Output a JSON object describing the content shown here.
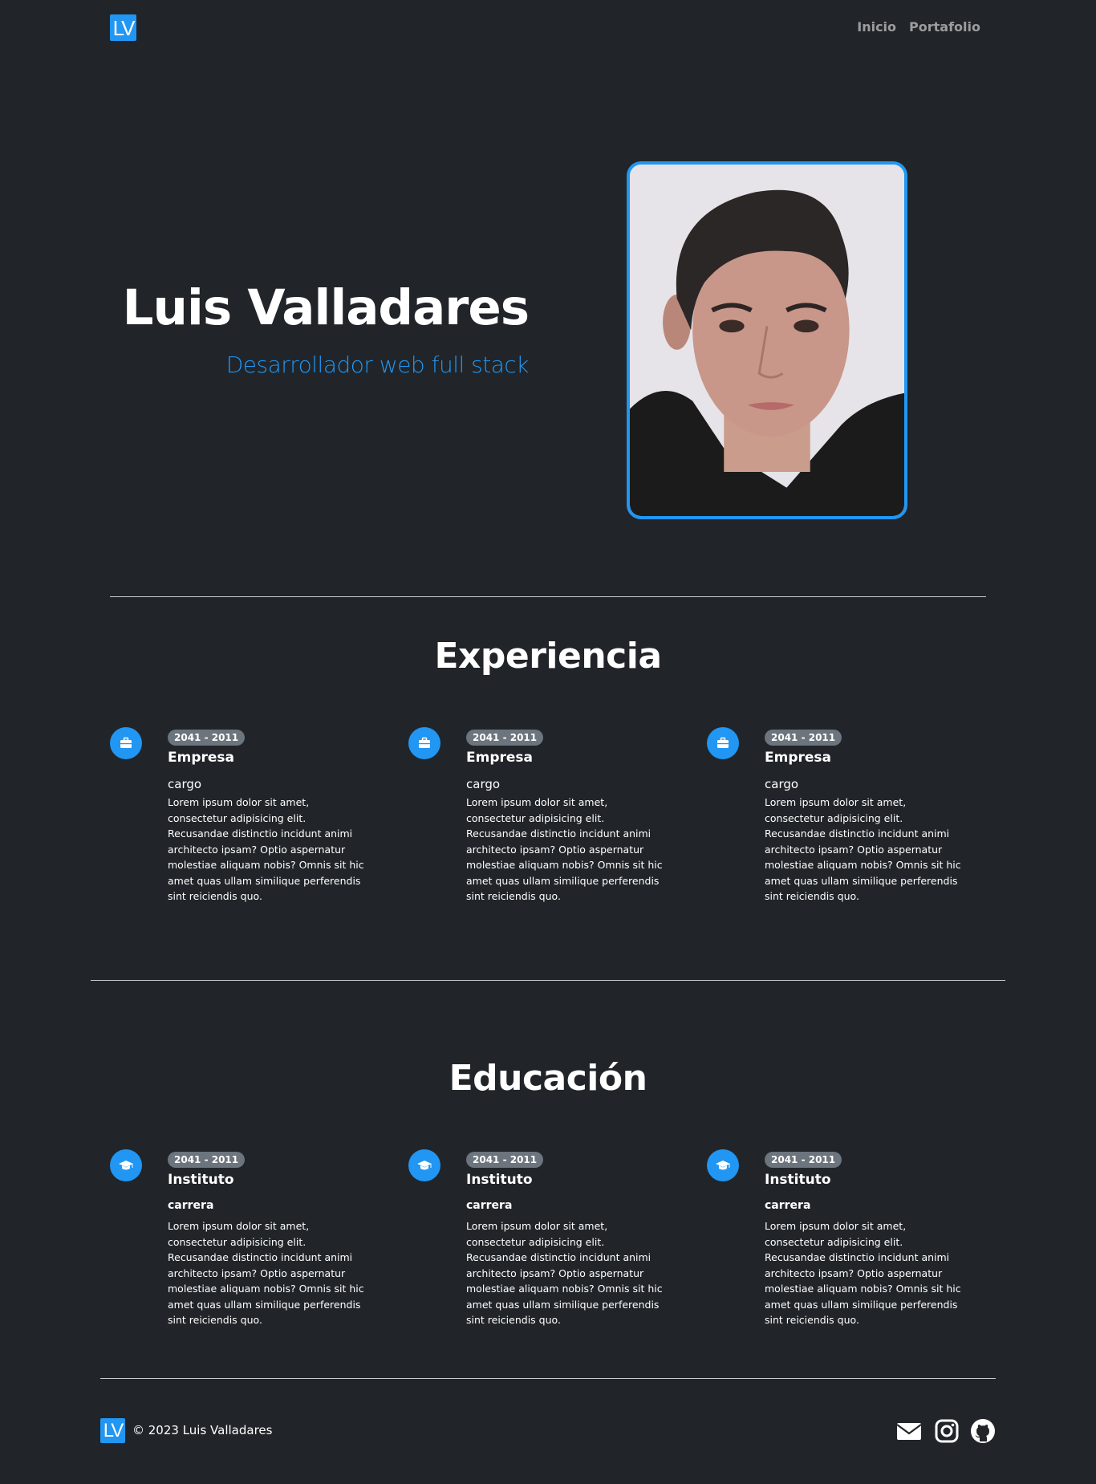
{
  "brand": {
    "logo_text": "LV",
    "logo_color": "#2196f3"
  },
  "nav": {
    "links": [
      {
        "label": "Inicio"
      },
      {
        "label": "Portafolio"
      }
    ]
  },
  "hero": {
    "name": "Luis Valladares",
    "role": "Desarrollador web full stack"
  },
  "experience": {
    "title": "Experiencia",
    "items": [
      {
        "icon": "briefcase-icon",
        "dates": "2041 - 2011",
        "company": "Empresa",
        "position": "cargo",
        "description": "Lorem ipsum dolor sit amet, consectetur adipisicing elit. Recusandae distinctio incidunt animi architecto ipsam? Optio aspernatur molestiae aliquam nobis? Omnis sit hic amet quas ullam similique perferendis sint reiciendis quo."
      },
      {
        "icon": "briefcase-icon",
        "dates": "2041 - 2011",
        "company": "Empresa",
        "position": "cargo",
        "description": "Lorem ipsum dolor sit amet, consectetur adipisicing elit. Recusandae distinctio incidunt animi architecto ipsam? Optio aspernatur molestiae aliquam nobis? Omnis sit hic amet quas ullam similique perferendis sint reiciendis quo."
      },
      {
        "icon": "briefcase-icon",
        "dates": "2041 - 2011",
        "company": "Empresa",
        "position": "cargo",
        "description": "Lorem ipsum dolor sit amet, consectetur adipisicing elit. Recusandae distinctio incidunt animi architecto ipsam? Optio aspernatur molestiae aliquam nobis? Omnis sit hic amet quas ullam similique perferendis sint reiciendis quo."
      }
    ]
  },
  "education": {
    "title": "Educación",
    "items": [
      {
        "icon": "graduation-cap-icon",
        "dates": "2041 - 2011",
        "institution": "Instituto",
        "program": "carrera",
        "description": "Lorem ipsum dolor sit amet, consectetur adipisicing elit. Recusandae distinctio incidunt animi architecto ipsam? Optio aspernatur molestiae aliquam nobis? Omnis sit hic amet quas ullam similique perferendis sint reiciendis quo."
      },
      {
        "icon": "graduation-cap-icon",
        "dates": "2041 - 2011",
        "institution": "Instituto",
        "program": "carrera",
        "description": "Lorem ipsum dolor sit amet, consectetur adipisicing elit. Recusandae distinctio incidunt animi architecto ipsam? Optio aspernatur molestiae aliquam nobis? Omnis sit hic amet quas ullam similique perferendis sint reiciendis quo."
      },
      {
        "icon": "graduation-cap-icon",
        "dates": "2041 - 2011",
        "institution": "Instituto",
        "program": "carrera",
        "description": "Lorem ipsum dolor sit amet, consectetur adipisicing elit. Recusandae distinctio incidunt animi architecto ipsam? Optio aspernatur molestiae aliquam nobis? Omnis sit hic amet quas ullam similique perferendis sint reiciendis quo."
      }
    ]
  },
  "footer": {
    "logo_text": "LV",
    "copyright": "© 2023 Luis Valladares",
    "social": [
      {
        "icon": "envelope-icon"
      },
      {
        "icon": "instagram-icon"
      },
      {
        "icon": "github-icon"
      }
    ]
  },
  "colors": {
    "background": "#212529",
    "accent": "#2196f3",
    "badge": "#6c757d",
    "divider": "#c9ccd0"
  }
}
